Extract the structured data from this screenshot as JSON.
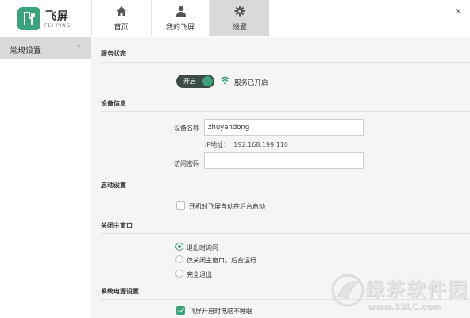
{
  "app": {
    "brand_cn": "飞屏",
    "brand_en": "FEI PING",
    "accent": "#3aa37b"
  },
  "tabs": [
    {
      "label": "首页",
      "icon": "home-icon"
    },
    {
      "label": "我的飞屏",
      "icon": "user-icon"
    },
    {
      "label": "设置",
      "icon": "gear-icon",
      "active": true
    }
  ],
  "sidebar": {
    "items": [
      {
        "label": "常规设置",
        "active": true
      }
    ]
  },
  "service": {
    "title": "服务状态",
    "toggle_label": "开启",
    "status_text": "服务已开启"
  },
  "device": {
    "title": "设备信息",
    "name_label": "设备名称",
    "name_value": "zhuyandong",
    "ip_label": "IP地址：",
    "ip_value": "192.168.199.110",
    "password_label": "访问密码",
    "password_value": ""
  },
  "startup": {
    "title": "启动设置",
    "option_label": "开机时飞屏自动在后台启动",
    "checked": false
  },
  "close_window": {
    "title": "关闭主窗口",
    "options": [
      {
        "label": "退出时询问",
        "selected": true
      },
      {
        "label": "仅关闭主窗口，后台运行",
        "selected": false
      },
      {
        "label": "完全退出",
        "selected": false
      }
    ]
  },
  "power": {
    "title": "系统电源设置",
    "option_label": "飞屏开启时电脑不睡眠",
    "checked": true
  },
  "watermark": {
    "site_cn": "绿茶软件园",
    "site_url": "www.33LC.com"
  }
}
